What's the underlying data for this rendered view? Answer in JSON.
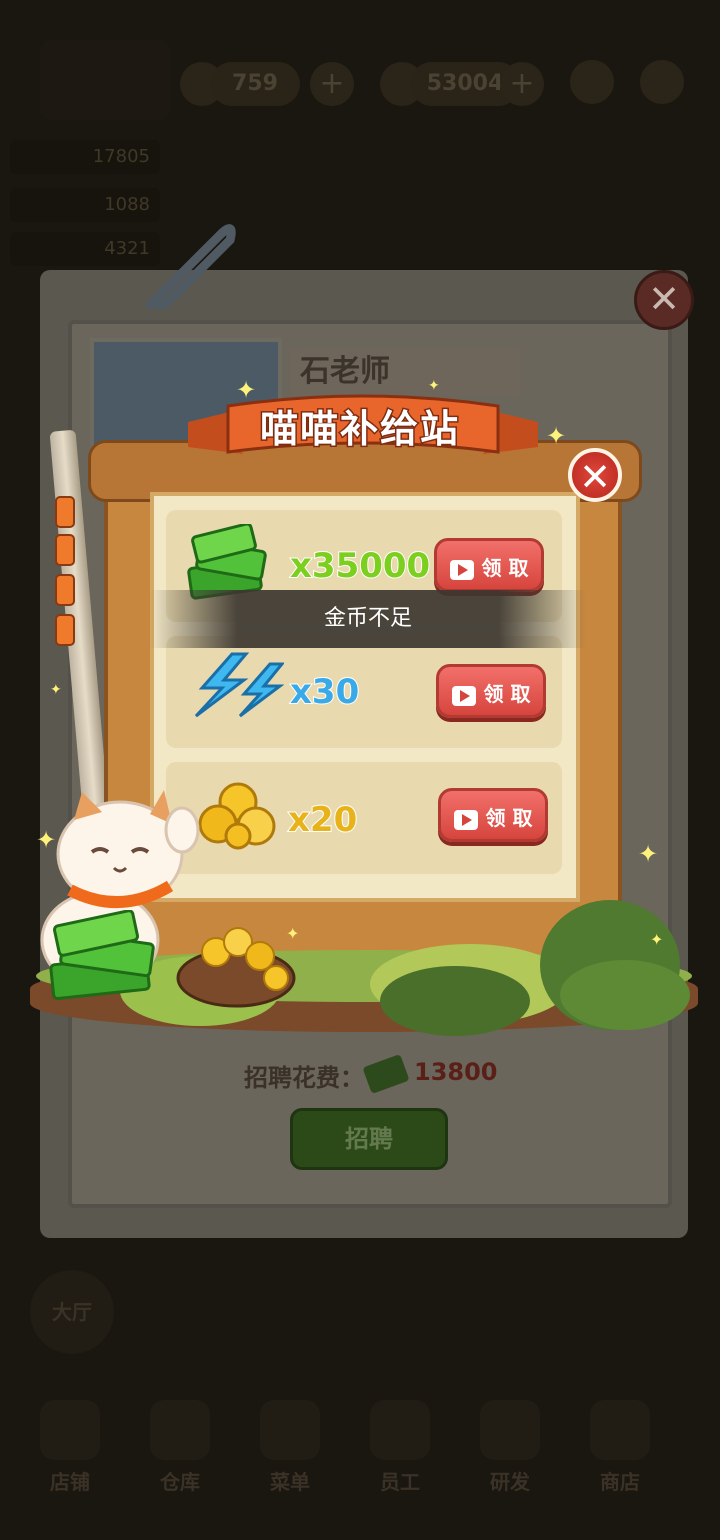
{
  "hud": {
    "currency_1": "759",
    "currency_2": "53004",
    "plus_1": "+",
    "plus_2": "+",
    "stat_1": "17805",
    "stat_2": "1088",
    "stat_3": "4321"
  },
  "card": {
    "name": "石老师",
    "close_label": "✕",
    "cost_label": "招聘花费：",
    "cost_value": "13800",
    "recruit_label": "招聘",
    "side_tab": "大厅"
  },
  "bottom_nav": [
    "店铺",
    "仓库",
    "菜单",
    "员工",
    "研发",
    "商店"
  ],
  "popup": {
    "title": "喵喵补给站",
    "close_label": "✕",
    "toast": "金币不足",
    "rewards": [
      {
        "amount": "x35000",
        "color": "#7ccf1f",
        "icon": "cash-stack-icon",
        "button_label": "领 取"
      },
      {
        "amount": "x30",
        "color": "#3aa9e8",
        "icon": "lightning-icon",
        "button_label": "领 取"
      },
      {
        "amount": "x20",
        "color": "#e8b31a",
        "icon": "gold-nuggets-icon",
        "button_label": "领 取"
      }
    ]
  }
}
